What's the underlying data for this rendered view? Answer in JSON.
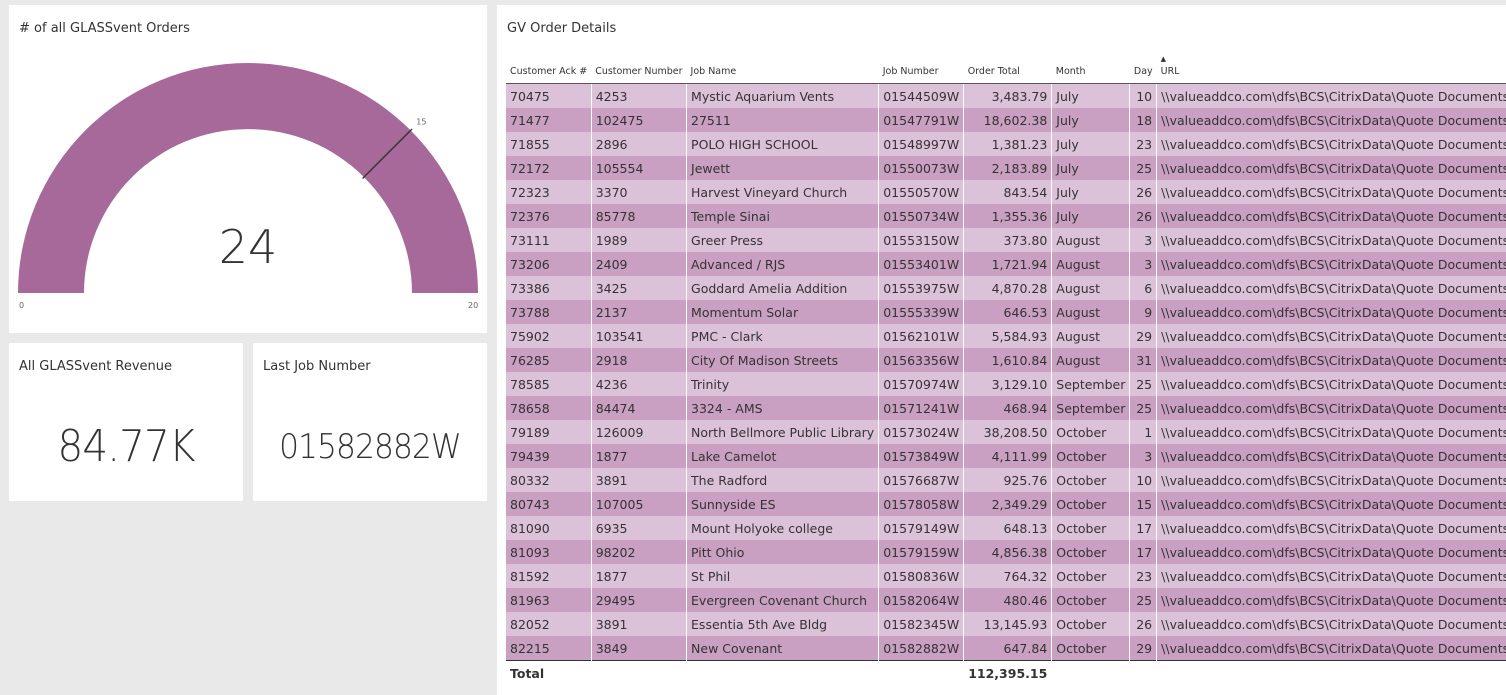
{
  "gauge": {
    "title": "# of all GLASSvent Orders",
    "value": "24",
    "min": "0",
    "max": "20",
    "target": "15",
    "color": "#a66999"
  },
  "revenue": {
    "title": "All GLASSvent Revenue",
    "value": "84.77K"
  },
  "last_job": {
    "title": "Last Job Number",
    "value": "01582882W"
  },
  "table": {
    "title": "GV Order Details",
    "headers": [
      "Customer Ack #",
      "Customer Number",
      "Job Name",
      "Job Number",
      "Order Total",
      "Month",
      "Day",
      "URL"
    ],
    "url_value": "\\\\valueaddco.com\\dfs\\BCS\\CitrixData\\Quote Documents\\Kav",
    "rows": [
      [
        "70475",
        "4253",
        "Mystic Aquarium Vents",
        "01544509W",
        "3,483.79",
        "July",
        "10"
      ],
      [
        "71477",
        "102475",
        "27511",
        "01547791W",
        "18,602.38",
        "July",
        "18"
      ],
      [
        "71855",
        "2896",
        "POLO HIGH SCHOOL",
        "01548997W",
        "1,381.23",
        "July",
        "23"
      ],
      [
        "72172",
        "105554",
        "Jewett",
        "01550073W",
        "2,183.89",
        "July",
        "25"
      ],
      [
        "72323",
        "3370",
        "Harvest Vineyard Church",
        "01550570W",
        "843.54",
        "July",
        "26"
      ],
      [
        "72376",
        "85778",
        "Temple Sinai",
        "01550734W",
        "1,355.36",
        "July",
        "26"
      ],
      [
        "73111",
        "1989",
        "Greer Press",
        "01553150W",
        "373.80",
        "August",
        "3"
      ],
      [
        "73206",
        "2409",
        "Advanced / RJS",
        "01553401W",
        "1,721.94",
        "August",
        "3"
      ],
      [
        "73386",
        "3425",
        "Goddard Amelia Addition",
        "01553975W",
        "4,870.28",
        "August",
        "6"
      ],
      [
        "73788",
        "2137",
        "Momentum Solar",
        "01555339W",
        "646.53",
        "August",
        "9"
      ],
      [
        "75902",
        "103541",
        "PMC - Clark",
        "01562101W",
        "5,584.93",
        "August",
        "29"
      ],
      [
        "76285",
        "2918",
        "City Of Madison Streets",
        "01563356W",
        "1,610.84",
        "August",
        "31"
      ],
      [
        "78585",
        "4236",
        "Trinity",
        "01570974W",
        "3,129.10",
        "September",
        "25"
      ],
      [
        "78658",
        "84474",
        "3324 - AMS",
        "01571241W",
        "468.94",
        "September",
        "25"
      ],
      [
        "79189",
        "126009",
        "North Bellmore Public Library",
        "01573024W",
        "38,208.50",
        "October",
        "1"
      ],
      [
        "79439",
        "1877",
        "Lake Camelot",
        "01573849W",
        "4,111.99",
        "October",
        "3"
      ],
      [
        "80332",
        "3891",
        "The Radford",
        "01576687W",
        "925.76",
        "October",
        "10"
      ],
      [
        "80743",
        "107005",
        "Sunnyside ES",
        "01578058W",
        "2,349.29",
        "October",
        "15"
      ],
      [
        "81090",
        "6935",
        "Mount Holyoke college",
        "01579149W",
        "648.13",
        "October",
        "17"
      ],
      [
        "81093",
        "98202",
        "Pitt Ohio",
        "01579159W",
        "4,856.38",
        "October",
        "17"
      ],
      [
        "81592",
        "1877",
        "St Phil",
        "01580836W",
        "764.32",
        "October",
        "23"
      ],
      [
        "81963",
        "29495",
        "Evergreen Covenant Church",
        "01582064W",
        "480.46",
        "October",
        "25"
      ],
      [
        "82052",
        "3891",
        "Essentia 5th Ave Bldg",
        "01582345W",
        "13,145.93",
        "October",
        "26"
      ],
      [
        "82215",
        "3849",
        "New Covenant",
        "01582882W",
        "647.84",
        "October",
        "29"
      ]
    ],
    "total_label": "Total",
    "total_value": "112,395.15",
    "row_colors": [
      "#dcc2d8",
      "#c9a0c1"
    ]
  }
}
